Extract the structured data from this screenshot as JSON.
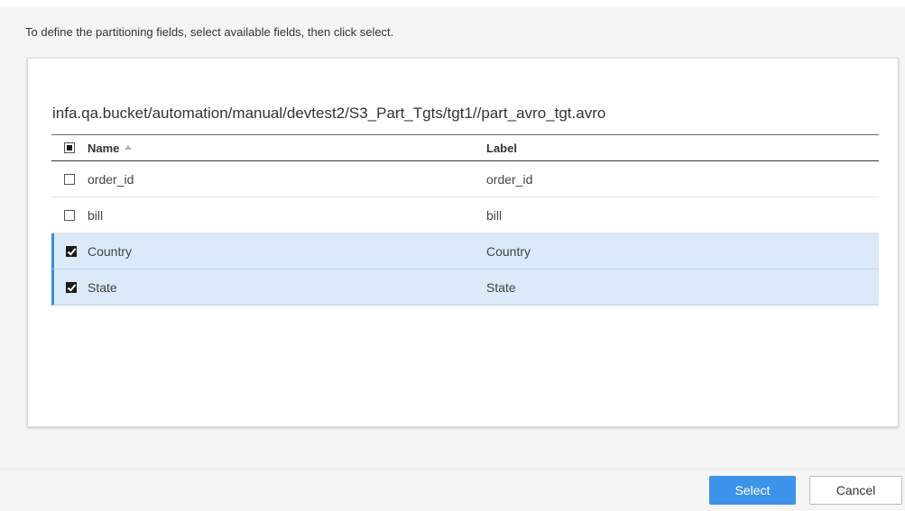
{
  "dialog": {
    "instruction": "To define the partitioning fields, select available fields, then click select.",
    "path": "infa.qa.bucket/automation/manual/devtest2/S3_Part_Tgts/tgt1//part_avro_tgt.avro"
  },
  "table": {
    "columns": {
      "name": "Name",
      "label": "Label"
    },
    "header_checkbox_state": "indeterminate",
    "rows": [
      {
        "name": "order_id",
        "label": "order_id",
        "checked": false
      },
      {
        "name": "bill",
        "label": "bill",
        "checked": false
      },
      {
        "name": "Country",
        "label": "Country",
        "checked": true
      },
      {
        "name": "State",
        "label": "State",
        "checked": true
      }
    ]
  },
  "buttons": {
    "select": "Select",
    "cancel": "Cancel"
  },
  "colors": {
    "primary": "#3d93ea",
    "selected_row": "#dbe9f8",
    "selected_accent": "#3b8ed9"
  }
}
